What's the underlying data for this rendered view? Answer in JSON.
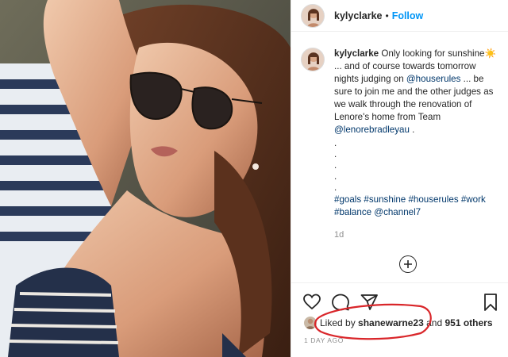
{
  "header": {
    "username": "kylyclarke",
    "separator": "•",
    "follow_label": "Follow"
  },
  "caption": {
    "username": "kylyclarke",
    "text_1": "Only looking for sunshine",
    "emoji": "☀️",
    "text_2": "... and of course towards tomorrow nights judging on",
    "mention_1": "@houserules",
    "text_3": "... be sure to join me and the other judges as we walk through the renovation of Lenore's home from Team",
    "mention_2": "@lenorebradleyau",
    "text_4": ".",
    "dot_lines": [
      ".",
      ".",
      ".",
      ".",
      "."
    ],
    "hashtags": "#goals #sunshine #houserules #work #balance",
    "mention_3": "@channel7",
    "age": "1d"
  },
  "actions": {
    "like_icon": "heart-icon",
    "comment_icon": "comment-icon",
    "share_icon": "share-icon",
    "save_icon": "bookmark-icon",
    "load_more_icon": "plus-circle-icon"
  },
  "likes": {
    "prefix": "Liked by",
    "user": "shanewarne23",
    "middle": "and",
    "others": "951 others"
  },
  "timestamp": "1 DAY AGO",
  "colors": {
    "link": "#00376b",
    "follow": "#0095f6",
    "annotation": "#d9262a"
  }
}
